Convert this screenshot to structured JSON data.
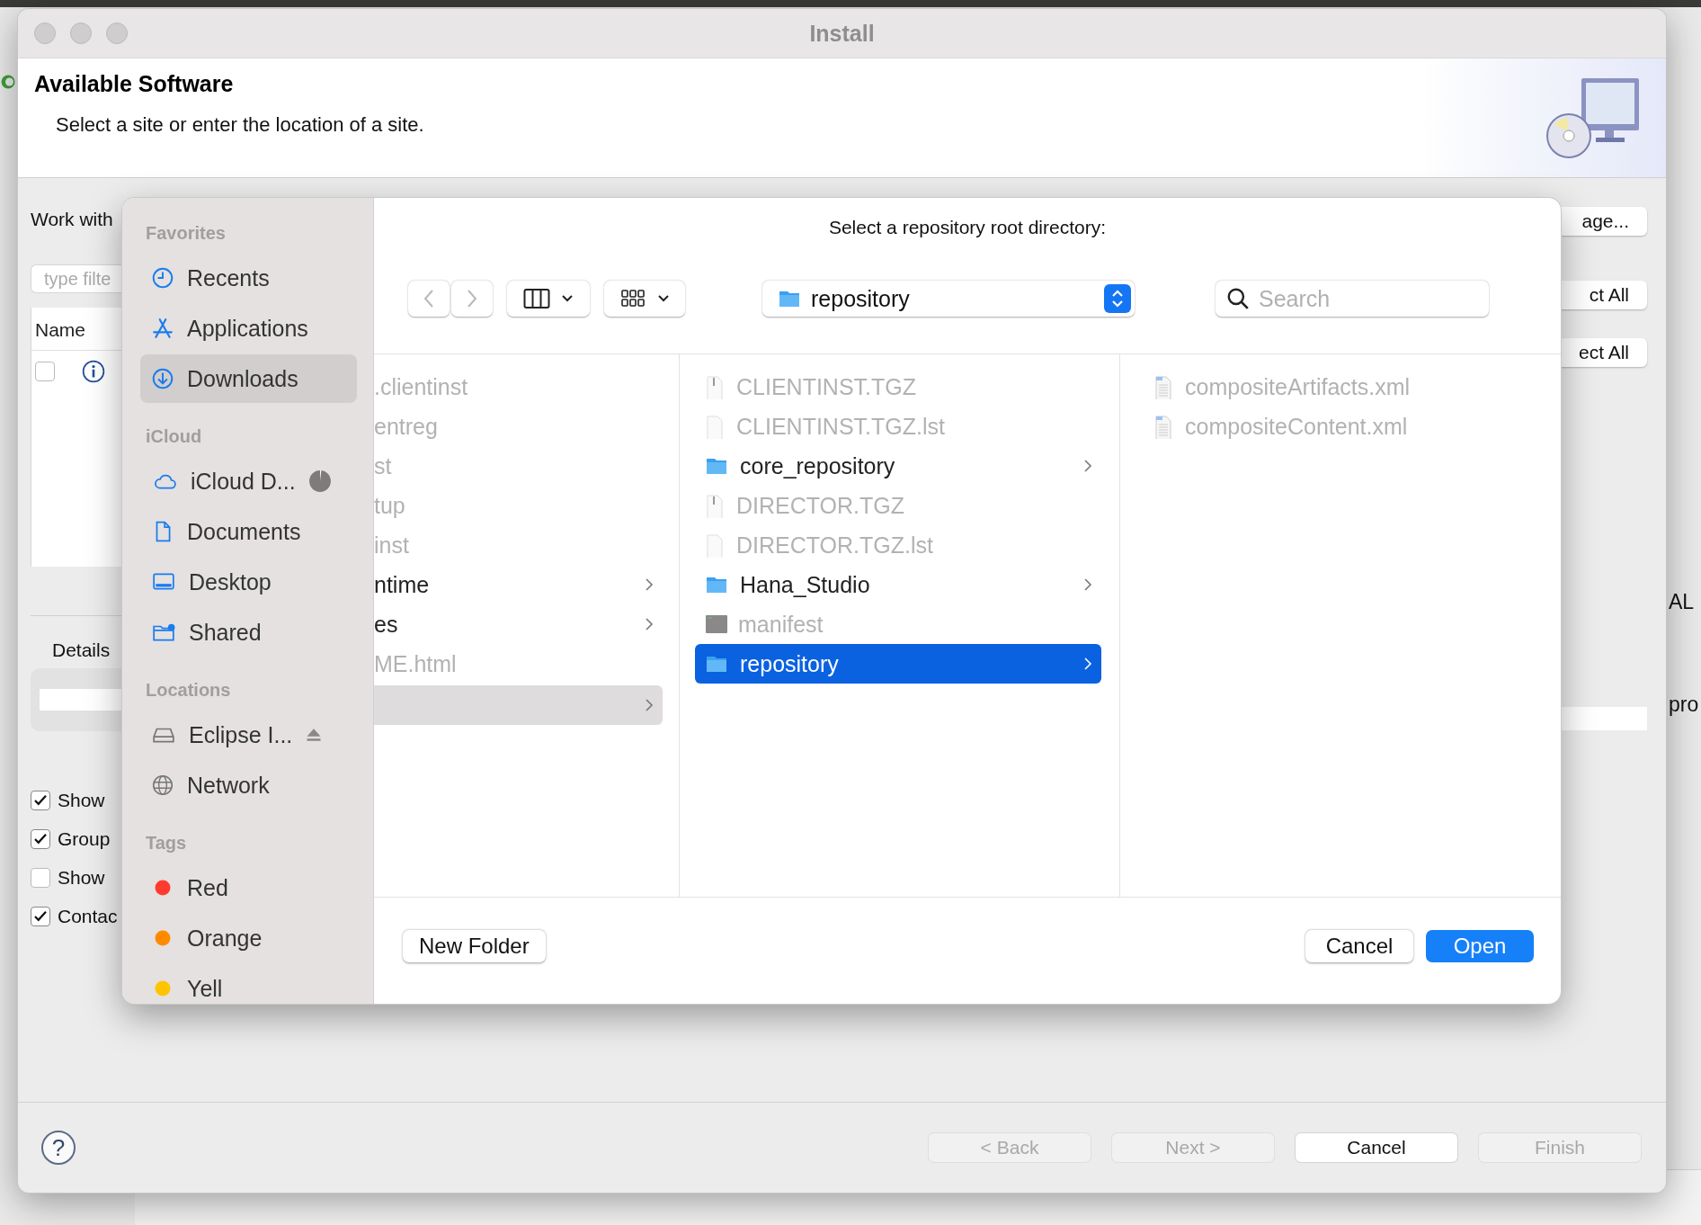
{
  "window": {
    "title": "Install"
  },
  "header": {
    "title": "Available Software",
    "subtitle": "Select a site or enter the location of a site."
  },
  "behind_left": {
    "work_with": "Work with",
    "filter_placeholder": "type filte",
    "name_column": "Name",
    "row_checked": false,
    "details": "Details",
    "options": [
      {
        "label": "Show",
        "checked": true
      },
      {
        "label": "Group",
        "checked": true
      },
      {
        "label": "Show",
        "checked": false
      },
      {
        "label": "Contac",
        "checked": true
      }
    ]
  },
  "behind_right": {
    "buttons": [
      "age...",
      "ct All",
      "ect All"
    ]
  },
  "dialog": {
    "prompt": "Select a repository root directory:",
    "path": "repository",
    "search_placeholder": "Search",
    "sidebar": [
      {
        "heading": "Favorites",
        "items": [
          {
            "label": "Recents",
            "kind": "recents",
            "selected": false
          },
          {
            "label": "Applications",
            "kind": "apps",
            "selected": false
          },
          {
            "label": "Downloads",
            "kind": "downloads",
            "selected": true
          }
        ]
      },
      {
        "heading": "iCloud",
        "items": [
          {
            "label": "iCloud D...",
            "kind": "cloud",
            "selected": false
          },
          {
            "label": "Documents",
            "kind": "documents",
            "selected": false
          },
          {
            "label": "Desktop",
            "kind": "desktop",
            "selected": false
          },
          {
            "label": "Shared",
            "kind": "shared",
            "selected": false
          }
        ]
      },
      {
        "heading": "Locations",
        "items": [
          {
            "label": "Eclipse I...",
            "kind": "drive",
            "selected": false
          },
          {
            "label": "Network",
            "kind": "network",
            "selected": false
          }
        ]
      },
      {
        "heading": "Tags",
        "items": [
          {
            "label": "Red",
            "kind": "tag",
            "color": "#ff3b30",
            "selected": false
          },
          {
            "label": "Orange",
            "kind": "tag",
            "color": "#ff8a00",
            "selected": false
          },
          {
            "label": "Yell",
            "kind": "tag",
            "color": "#ffc400",
            "selected": false
          }
        ]
      }
    ],
    "columns": [
      [
        {
          "name": ".clientinst",
          "dimmed": true,
          "has_children": false,
          "selected": false
        },
        {
          "name": "entreg",
          "dimmed": true,
          "has_children": false,
          "selected": false
        },
        {
          "name": "st",
          "dimmed": true,
          "has_children": false,
          "selected": false
        },
        {
          "name": "tup",
          "dimmed": true,
          "has_children": false,
          "selected": false
        },
        {
          "name": "inst",
          "dimmed": true,
          "has_children": false,
          "selected": false
        },
        {
          "name": "ntime",
          "dimmed": false,
          "has_children": true,
          "selected": false
        },
        {
          "name": "es",
          "dimmed": false,
          "has_children": true,
          "selected": false
        },
        {
          "name": "ME.html",
          "dimmed": true,
          "has_children": false,
          "selected": false
        },
        {
          "dimmed": false,
          "has_children": true,
          "selected": true
        }
      ],
      [
        {
          "name": "CLIENTINST.TGZ",
          "kind": "archive",
          "dimmed": true,
          "has_children": false,
          "selected": false
        },
        {
          "name": "CLIENTINST.TGZ.lst",
          "kind": "doc",
          "dimmed": true,
          "has_children": false,
          "selected": false
        },
        {
          "name": "core_repository",
          "kind": "folder",
          "dimmed": false,
          "has_children": true,
          "selected": false
        },
        {
          "name": "DIRECTOR.TGZ",
          "kind": "archive",
          "dimmed": true,
          "has_children": false,
          "selected": false
        },
        {
          "name": "DIRECTOR.TGZ.lst",
          "kind": "doc",
          "dimmed": true,
          "has_children": false,
          "selected": false
        },
        {
          "name": "Hana_Studio",
          "kind": "folder",
          "dimmed": false,
          "has_children": true,
          "selected": false
        },
        {
          "name": "manifest",
          "kind": "exec",
          "dimmed": true,
          "has_children": false,
          "selected": false
        },
        {
          "name": "repository",
          "kind": "folder",
          "dimmed": false,
          "has_children": true,
          "selected": true
        }
      ],
      [
        {
          "name": "compositeArtifacts.xml",
          "kind": "xml",
          "dimmed": true,
          "has_children": false,
          "selected": false
        },
        {
          "name": "compositeContent.xml",
          "kind": "xml",
          "dimmed": true,
          "has_children": false,
          "selected": false
        }
      ]
    ],
    "new_folder": "New Folder",
    "cancel": "Cancel",
    "open": "Open"
  },
  "wizard": {
    "help": "?",
    "buttons": [
      {
        "label": "< Back",
        "disabled": true
      },
      {
        "label": "Next >",
        "disabled": true
      },
      {
        "label": "Cancel",
        "disabled": false
      },
      {
        "label": "Finish",
        "disabled": true
      }
    ]
  },
  "workbench": {
    "side_texts": [
      "AL",
      "pro"
    ]
  }
}
